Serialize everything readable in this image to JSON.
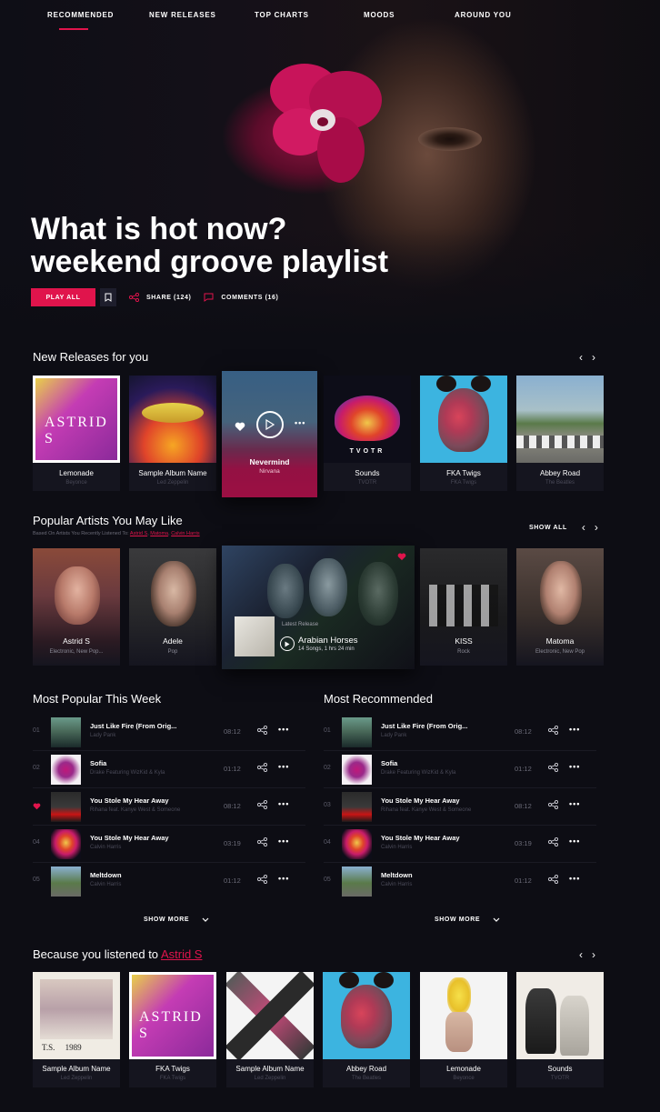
{
  "nav": {
    "items": [
      "RECOMMENDED",
      "NEW RELEASES",
      "TOP CHARTS",
      "MOODS",
      "AROUND YOU"
    ],
    "active": "RECOMMENDED",
    "accent_color": "#e0144c"
  },
  "hero": {
    "title_line1": "What is hot now?",
    "title_line2": "weekend groove playlist",
    "play_all": "PLAY ALL",
    "share": "SHARE (124)",
    "comments": "COMMENTS (16)"
  },
  "new_releases": {
    "title": "New Releases for you",
    "items": [
      {
        "title": "Lemonade",
        "artist": "Beyonce"
      },
      {
        "title": "Sample Album Name",
        "artist": "Led Zeppelin"
      },
      {
        "title": "Nevermind",
        "artist": "Nirvana"
      },
      {
        "title": "Sounds",
        "artist": "TVOTR"
      },
      {
        "title": "FKA Twigs",
        "artist": "FKA Twigs"
      },
      {
        "title": "Abbey Road",
        "artist": "The Beatles"
      }
    ]
  },
  "popular_artists": {
    "title": "Popular Artists You May Like",
    "subtitle_prefix": "Based On Artists You Recently Listened To:",
    "subtitle_links": [
      "Astrid S",
      "Matoma",
      "Calvin Harris"
    ],
    "show_all": "SHOW ALL",
    "items": [
      {
        "name": "Astrid S",
        "genre": "Electronic, New Pop..."
      },
      {
        "name": "Adele",
        "genre": "Pop"
      },
      {
        "name": "KISS",
        "genre": "Rock"
      },
      {
        "name": "Matoma",
        "genre": "Electronic, New Pop"
      }
    ],
    "featured": {
      "tag": "Latest Release",
      "title": "Arabian Horses",
      "meta": "14 Songs, 1 hrs 24 min"
    }
  },
  "most_popular": {
    "title": "Most Popular This Week",
    "show_more": "SHOW MORE",
    "tracks": [
      {
        "num": "01",
        "title": "Just Like Fire (From Orig...",
        "artist": "Lady Pank",
        "duration": "08:12"
      },
      {
        "num": "02",
        "title": "Sofia",
        "artist": "Drake Featuring WizKid & Kyla",
        "duration": "01:12"
      },
      {
        "num": "03",
        "title": "You Stole My Hear Away",
        "artist": "Rihana feat. Kanye West & Someone",
        "duration": "08:12"
      },
      {
        "num": "04",
        "title": "You Stole My Hear Away",
        "artist": "Calvin Harris",
        "duration": "03:19"
      },
      {
        "num": "05",
        "title": "Meltdown",
        "artist": "Calvin Harris",
        "duration": "01:12"
      }
    ]
  },
  "most_recommended": {
    "title": "Most Recommended",
    "show_more": "SHOW MORE",
    "tracks": [
      {
        "num": "01",
        "title": "Just Like Fire (From Orig...",
        "artist": "Lady Pank",
        "duration": "08:12"
      },
      {
        "num": "02",
        "title": "Sofia",
        "artist": "Drake Featuring WizKid & Kyla",
        "duration": "01:12"
      },
      {
        "num": "03",
        "title": "You Stole My Hear Away",
        "artist": "Rihana feat. Kanye West & Someone",
        "duration": "08:12"
      },
      {
        "num": "04",
        "title": "You Stole My Hear Away",
        "artist": "Calvin Harris",
        "duration": "03:19"
      },
      {
        "num": "05",
        "title": "Meltdown",
        "artist": "Calvin Harris",
        "duration": "01:12"
      }
    ]
  },
  "because": {
    "title_prefix": "Because you listened to",
    "title_link": "Astrid S",
    "items": [
      {
        "title": "Sample Album Name",
        "artist": "Led Zeppelin",
        "cover_text": "T.S.     1989"
      },
      {
        "title": "FKA Twigs",
        "artist": "FKA Twigs"
      },
      {
        "title": "Sample Album Name",
        "artist": "Led Zeppelin"
      },
      {
        "title": "Abbey Road",
        "artist": "The Beatles"
      },
      {
        "title": "Lemonade",
        "artist": "Beyonce"
      },
      {
        "title": "Sounds",
        "artist": "TVOTR"
      }
    ]
  },
  "icons": {
    "bookmark": "bookmark-icon",
    "share": "share-icon",
    "comment": "comment-icon",
    "heart": "heart-icon",
    "play": "play-icon",
    "more": "more-icon",
    "prev": "chevron-left-icon",
    "next": "chevron-right-icon"
  }
}
